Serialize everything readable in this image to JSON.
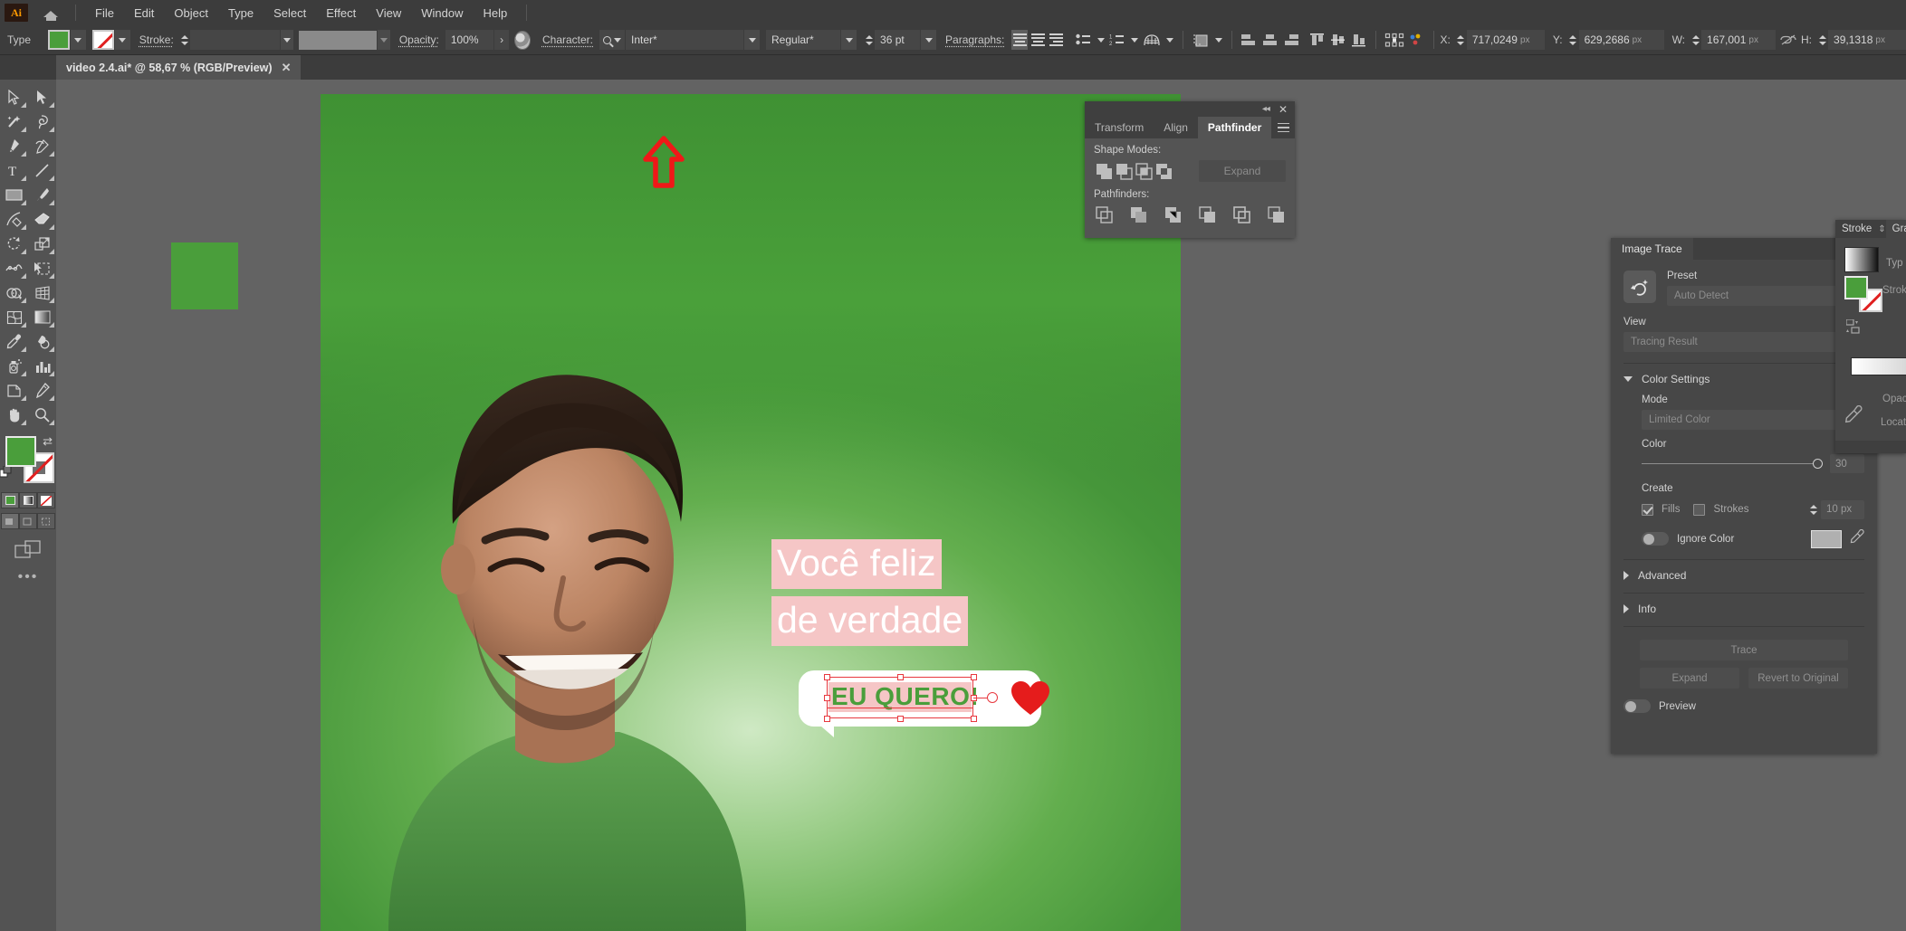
{
  "app": {
    "logo": "Ai",
    "home_icon": "home-icon"
  },
  "menubar": {
    "items": [
      "File",
      "Edit",
      "Object",
      "Type",
      "Select",
      "Effect",
      "View",
      "Window",
      "Help"
    ]
  },
  "controlbar": {
    "tool_label": "Type",
    "fill_color": "#4a9e3b",
    "stroke_label": "Stroke:",
    "stroke_weight": "",
    "stroke_profile": "",
    "opacity_label": "Opacity:",
    "opacity_value": "100%",
    "opacity_next": "›",
    "recolor_icon": "recolor-artwork-icon",
    "character_label": "Character:",
    "font_family": "Inter*",
    "font_style": "Regular*",
    "font_size": "36 pt",
    "paragraph_label": "Paragraphs:",
    "align_left_icon": "align-left-icon",
    "align_center_icon": "align-center-icon",
    "align_right_icon": "align-right-icon",
    "bullet_list_icon": "bullet-list-icon",
    "number_list_icon": "numbered-list-icon",
    "basket_icon": "text-wrap-icon",
    "transform_icon": "transform-icon",
    "align_objects": [
      "align-left-edges-icon",
      "align-horizontal-center-icon",
      "align-right-edges-icon",
      "align-top-edges-icon",
      "align-vertical-center-icon",
      "align-bottom-edges-icon"
    ],
    "distribute_icon": "distribute-spacing-icon",
    "x_label": "X:",
    "x_value": "717,0249",
    "y_label": "Y:",
    "y_value": "629,2686",
    "w_label": "W:",
    "w_value": "167,001",
    "h_label": "H:",
    "h_value": "39,1318",
    "unit": "px",
    "link_icon": "constrain-proportions-unlinked-icon"
  },
  "tabbar": {
    "document_title": "video 2.4.ai* @ 58,67 % (RGB/Preview)",
    "close_label": "✕"
  },
  "toolbar": {
    "tools": [
      "selection-tool",
      "direct-selection-tool",
      "magic-wand-tool",
      "lasso-tool",
      "pen-tool",
      "curvature-tool",
      "type-tool",
      "line-segment-tool",
      "rectangle-tool",
      "paintbrush-tool",
      "shaper-tool",
      "eraser-tool",
      "rotate-tool",
      "scale-tool",
      "width-tool",
      "free-transform-tool",
      "shape-builder-tool",
      "perspective-grid-tool",
      "mesh-tool",
      "gradient-tool",
      "eyedropper-tool",
      "blend-tool",
      "symbol-sprayer-tool",
      "column-graph-tool",
      "artboard-tool",
      "slice-tool",
      "hand-tool",
      "zoom-tool"
    ],
    "fill_color": "#4a9e3b",
    "stroke_none": true,
    "fill_stroke_swap_icon": "swap-fill-stroke-icon",
    "color_mode_icons": [
      "color-swatch-icon",
      "gradient-icon",
      "none-icon"
    ],
    "drawing_mode_icons": [
      "draw-normal-icon",
      "draw-behind-icon",
      "draw-inside-icon"
    ],
    "screen_mode_icon": "change-screen-mode-icon",
    "more_tools": "•••"
  },
  "canvas": {
    "artwork_square_color": "#4a9e3b",
    "artboard_bg_top": "#3f9133",
    "artboard_bg_center": "#cfe9c4",
    "headline_line1": "Você feliz",
    "headline_line2": "de verdade",
    "headline_text_color": "#ffffff",
    "headline_highlight_color": "#f5c6c6",
    "bubble_text": "EU QUERO!",
    "bubble_text_color": "#4a9e3b",
    "bubble_bg": "#ffffff",
    "selection_color": "#e8383f",
    "heart_color": "#e51c1c",
    "annotation_arrow": "red-up-arrow-annotation"
  },
  "pathfinder_panel": {
    "tabs": [
      "Transform",
      "Align",
      "Pathfinder"
    ],
    "active_tab": "Pathfinder",
    "collapse_icon": "◂◂",
    "close_icon": "✕",
    "menu_icon": "panel-menu-icon",
    "shape_modes_label": "Shape Modes:",
    "shape_mode_icons": [
      "unite-icon",
      "minus-front-icon",
      "intersect-icon",
      "exclude-icon"
    ],
    "expand_label": "Expand",
    "pathfinders_label": "Pathfinders:",
    "pathfinder_icons": [
      "divide-icon",
      "trim-icon",
      "merge-icon",
      "crop-icon",
      "outline-icon",
      "minus-back-icon"
    ]
  },
  "image_trace_panel": {
    "tab_label": "Image Trace",
    "preset_icon": "auto-trace-icon",
    "preset_label": "Preset",
    "preset_value": "Auto Detect",
    "view_label": "View",
    "view_value": "Tracing Result",
    "color_settings_label": "Color Settings",
    "mode_label": "Mode",
    "mode_value": "Limited Color",
    "color_label": "Color",
    "color_value": "30",
    "create_label": "Create",
    "fills_label": "Fills",
    "fills_checked": true,
    "strokes_label": "Strokes",
    "strokes_checked": false,
    "stroke_width_value": "10 px",
    "ignore_color_label": "Ignore Color",
    "ignore_color_on": false,
    "eyedropper_icon": "eyedropper-icon",
    "advanced_label": "Advanced",
    "info_label": "Info",
    "trace_label": "Trace",
    "expand_label": "Expand",
    "revert_label": "Revert to Original",
    "preview_label": "Preview",
    "preview_on": false
  },
  "stroke_gradient_panel": {
    "tab_stroke": "Stroke",
    "tab_gradient": "Gra",
    "type_label": "Typ",
    "stroke_label": "Strok",
    "opacity_label": "Opacit",
    "location_label": "Locatio",
    "eyedropper_icon": "eyedropper-icon",
    "fill_color": "#4a9e3b"
  }
}
